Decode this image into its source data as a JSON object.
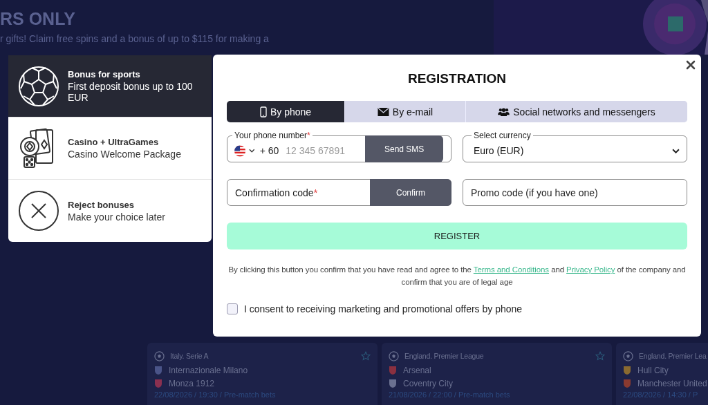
{
  "hero": {
    "title": "RS ONLY",
    "subtitle": "r gifts! Claim free spins and a bonus of up to $115 for making a"
  },
  "bonuses": [
    {
      "kind": "sports",
      "title": "Bonus for sports",
      "subtitle": "First deposit bonus up to 100 EUR",
      "selected": true
    },
    {
      "kind": "casino",
      "title": "Casino + UltraGames",
      "subtitle": "Casino Welcome Package",
      "selected": false
    },
    {
      "kind": "reject",
      "title": "Reject bonuses",
      "subtitle": "Make your choice later",
      "selected": false
    }
  ],
  "registration": {
    "title": "REGISTRATION",
    "tabs": [
      {
        "kind": "phone",
        "label": "By phone",
        "selected": true
      },
      {
        "kind": "email",
        "label": "By e-mail",
        "selected": false
      },
      {
        "kind": "social",
        "label": "Social networks and messengers",
        "selected": false
      }
    ],
    "phone": {
      "label": "Your phone number",
      "required_mark": "*",
      "code": "+ 60",
      "placeholder": "12 345 67891",
      "button": "Send SMS"
    },
    "currency": {
      "label": "Select currency",
      "value": "Euro (EUR)"
    },
    "confirmation": {
      "placeholder": "Confirmation code",
      "required_mark": "*",
      "button": "Confirm"
    },
    "promo": {
      "placeholder": "Promo code (if you have one)"
    },
    "register": "REGISTER",
    "legal": {
      "before": "By clicking this button you confirm that you have read and agree to the",
      "link_1": "Terms and Conditions",
      "middle": "and",
      "link_2": "Privacy Policy",
      "after": "of the company and confirm that you are of legal age"
    },
    "consent": {
      "label": "I consent to receiving marketing and promotional offers by phone",
      "checked": false
    }
  },
  "matches": [
    {
      "league": "Italy. Serie A",
      "favorite": false,
      "teams": [
        {
          "name": "Internazionale Milano",
          "color": "#4a5488"
        },
        {
          "name": "Monza 1912",
          "color": "#8a3050"
        }
      ],
      "time": "22/08/2026 / 19:30 / Pre-match bets"
    },
    {
      "league": "England. Premier League",
      "favorite": false,
      "teams": [
        {
          "name": "Arsenal",
          "color": "#8a3040"
        },
        {
          "name": "Coventry City",
          "color": "#6a7090"
        }
      ],
      "time": "21/08/2026 / 22:00 / Pre-match bets"
    },
    {
      "league": "England. Premier Lea",
      "teams": [
        {
          "name": "Hull City",
          "color": "#8a6a30"
        },
        {
          "name": "Manchester United",
          "color": "#8a3a30"
        }
      ],
      "time": "22/08/2026 / 14:30 / P"
    }
  ]
}
